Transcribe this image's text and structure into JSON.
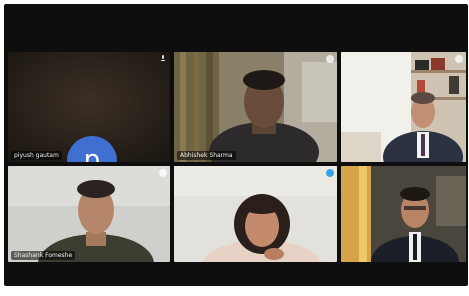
{
  "app": {
    "accent_color": "#3f6fd0",
    "background_color": "#0e0e0e"
  },
  "participants": [
    {
      "name": "piyush gautam",
      "avatar_initial": "p",
      "video": "off"
    },
    {
      "name": "Abhishek Sharma",
      "video": "on"
    },
    {
      "name": "",
      "video": "on"
    },
    {
      "name": "Shashank Fomeshe",
      "video": "on"
    },
    {
      "name": "",
      "video": "on"
    },
    {
      "name": "",
      "video": "on"
    }
  ],
  "icons": {
    "status": "mic-muted-icon",
    "speaking": "speaking-indicator-icon"
  }
}
